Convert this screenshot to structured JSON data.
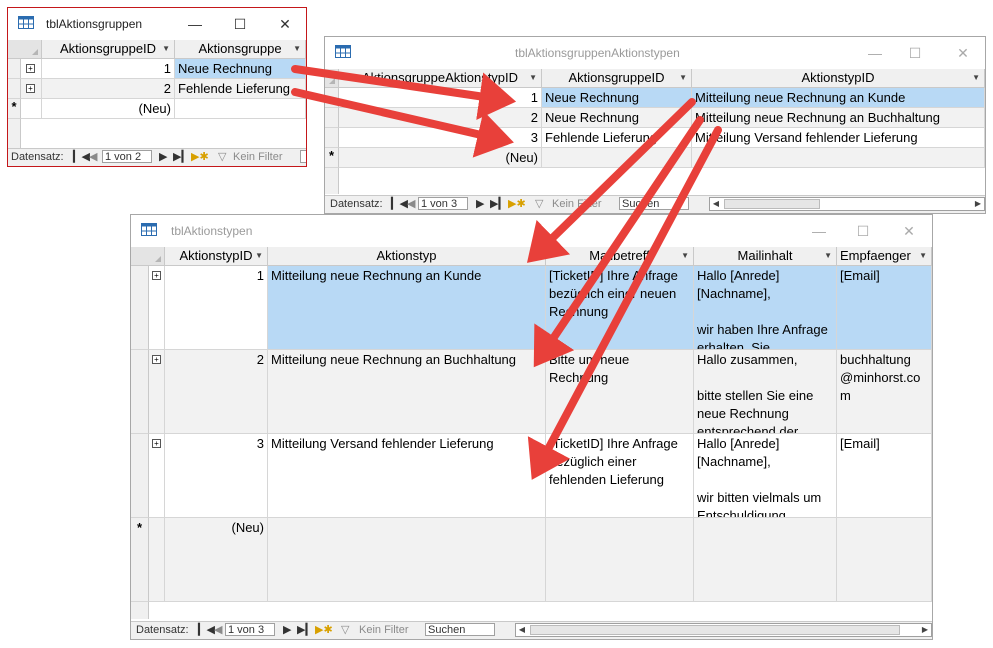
{
  "windows": {
    "gruppen": {
      "title": "tblAktionsgruppen",
      "columns": [
        "AktionsgruppeID",
        "Aktionsgruppe"
      ],
      "rows": [
        {
          "id": "1",
          "name": "Neue Rechnung"
        },
        {
          "id": "2",
          "name": "Fehlende Lieferung"
        }
      ],
      "new_label": "(Neu)",
      "nav": {
        "label": "Datensatz:",
        "position": "1 von 2",
        "filter": "Kein Filter"
      }
    },
    "gruppenTypen": {
      "title": "tblAktionsgruppenAktionstypen",
      "columns": [
        "AktionsgruppeAktionstypID",
        "AktionsgruppeID",
        "AktionstypID"
      ],
      "rows": [
        {
          "id": "1",
          "gruppe": "Neue Rechnung",
          "typ": "Mitteilung neue Rechnung an Kunde"
        },
        {
          "id": "2",
          "gruppe": "Neue Rechnung",
          "typ": "Mitteilung neue Rechnung an Buchhaltung"
        },
        {
          "id": "3",
          "gruppe": "Fehlende Lieferung",
          "typ": "Mitteilung Versand fehlender Lieferung"
        }
      ],
      "new_label": "(Neu)",
      "nav": {
        "label": "Datensatz:",
        "position": "1 von 3",
        "filter": "Kein Filter",
        "search": "Suchen"
      }
    },
    "typen": {
      "title": "tblAktionstypen",
      "columns": [
        "AktionstypID",
        "Aktionstyp",
        "Mailbetreff",
        "Mailinhalt",
        "Empfaenger"
      ],
      "rows": [
        {
          "id": "1",
          "typ": "Mitteilung neue Rechnung an Kunde",
          "betreff": "[TicketID] Ihre Anfrage bezüglich einer neuen Rechnung",
          "inhalt": "Hallo [Anrede] [Nachname],\n\nwir haben Ihre Anfrage erhalten. Sie",
          "empf": "[Email]"
        },
        {
          "id": "2",
          "typ": "Mitteilung neue Rechnung an Buchhaltung",
          "betreff": "Bitte um neue Rechnung",
          "inhalt": "Hallo zusammen,\n\nbitte stellen Sie eine neue Rechnung entsprechend der",
          "empf": "buchhaltung @minhorst.com"
        },
        {
          "id": "3",
          "typ": "Mitteilung Versand fehlender Lieferung",
          "betreff": "[TicketID] Ihre Anfrage bezüglich einer fehlenden Lieferung",
          "inhalt": "Hallo [Anrede] [Nachname],\n\nwir bitten vielmals um Entschuldigung",
          "empf": "[Email]"
        }
      ],
      "new_label": "(Neu)",
      "nav": {
        "label": "Datensatz:",
        "position": "1 von 3",
        "filter": "Kein Filter",
        "search": "Suchen"
      }
    }
  },
  "colors": {
    "selection": "#b8d9f5",
    "arrow": "#e8403a",
    "active_border": "#c4171a"
  },
  "icons": {
    "table": "table-icon",
    "minimize": "minimize-icon",
    "maximize": "maximize-icon",
    "close": "close-icon",
    "filter": "filter-icon"
  }
}
